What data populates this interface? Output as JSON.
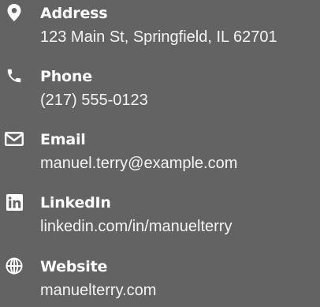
{
  "contacts": {
    "address": {
      "label": "Address",
      "value": "123 Main St, Springfield, IL 62701",
      "icon": "map-marker-icon"
    },
    "phone": {
      "label": "Phone",
      "value": "(217) 555-0123",
      "icon": "phone-icon"
    },
    "email": {
      "label": "Email",
      "value": "manuel.terry@example.com",
      "icon": "envelope-icon"
    },
    "linkedin": {
      "label": "LinkedIn",
      "value": "linkedin.com/in/manuelterry",
      "icon": "linkedin-icon"
    },
    "website": {
      "label": "Website",
      "value": "manuelterry.com",
      "icon": "globe-icon"
    }
  },
  "colors": {
    "background": "#636363",
    "text": "#ffffff"
  }
}
